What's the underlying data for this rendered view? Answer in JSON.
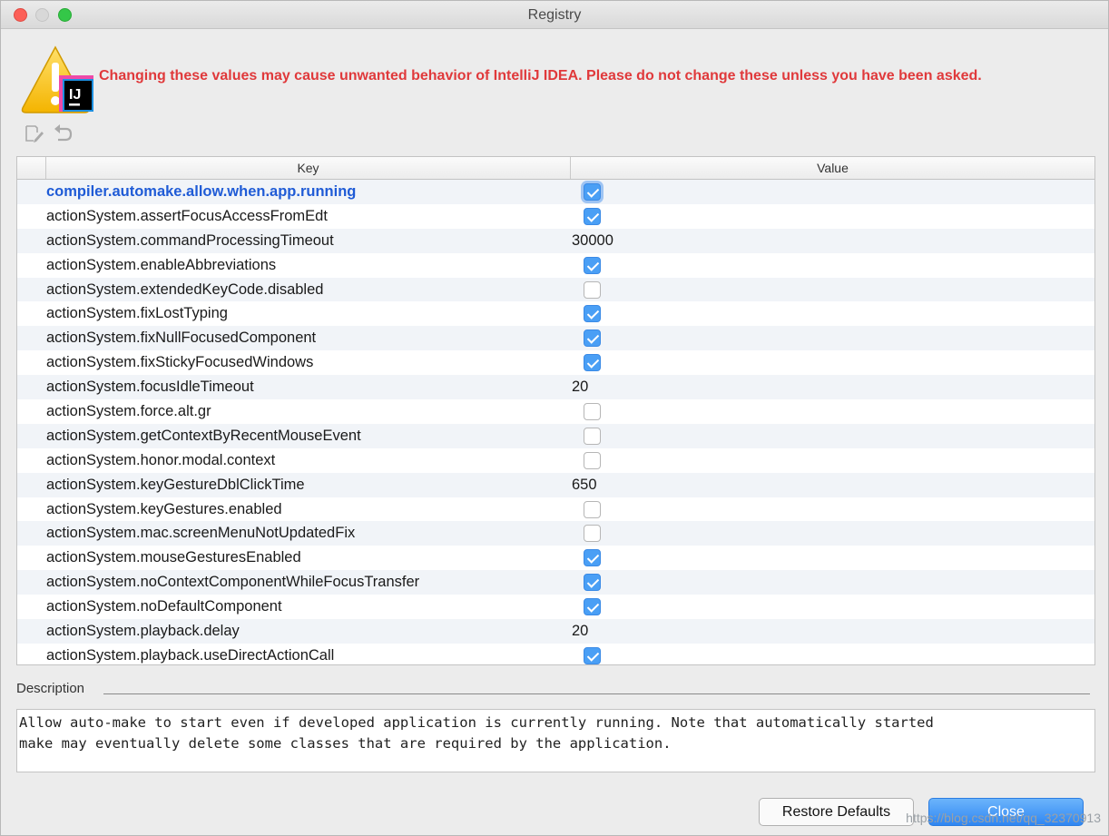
{
  "window": {
    "title": "Registry"
  },
  "header": {
    "warning_icon": "intellij-warning-icon",
    "warning_text": "Changing these values may cause unwanted behavior of IntelliJ IDEA. Please do not change these unless you have been asked."
  },
  "toolbar": {
    "edit_icon": "edit-icon",
    "undo_icon": "undo-icon"
  },
  "table": {
    "columns": [
      "Key",
      "Value"
    ],
    "rows": [
      {
        "key": "compiler.automake.allow.when.app.running",
        "type": "checkbox",
        "checked": true,
        "selected": true
      },
      {
        "key": "actionSystem.assertFocusAccessFromEdt",
        "type": "checkbox",
        "checked": true
      },
      {
        "key": "actionSystem.commandProcessingTimeout",
        "type": "text",
        "value": "30000"
      },
      {
        "key": "actionSystem.enableAbbreviations",
        "type": "checkbox",
        "checked": true
      },
      {
        "key": "actionSystem.extendedKeyCode.disabled",
        "type": "checkbox",
        "checked": false
      },
      {
        "key": "actionSystem.fixLostTyping",
        "type": "checkbox",
        "checked": true
      },
      {
        "key": "actionSystem.fixNullFocusedComponent",
        "type": "checkbox",
        "checked": true
      },
      {
        "key": "actionSystem.fixStickyFocusedWindows",
        "type": "checkbox",
        "checked": true
      },
      {
        "key": "actionSystem.focusIdleTimeout",
        "type": "text",
        "value": "20"
      },
      {
        "key": "actionSystem.force.alt.gr",
        "type": "checkbox",
        "checked": false
      },
      {
        "key": "actionSystem.getContextByRecentMouseEvent",
        "type": "checkbox",
        "checked": false
      },
      {
        "key": "actionSystem.honor.modal.context",
        "type": "checkbox",
        "checked": false
      },
      {
        "key": "actionSystem.keyGestureDblClickTime",
        "type": "text",
        "value": "650"
      },
      {
        "key": "actionSystem.keyGestures.enabled",
        "type": "checkbox",
        "checked": false
      },
      {
        "key": "actionSystem.mac.screenMenuNotUpdatedFix",
        "type": "checkbox",
        "checked": false
      },
      {
        "key": "actionSystem.mouseGesturesEnabled",
        "type": "checkbox",
        "checked": true
      },
      {
        "key": "actionSystem.noContextComponentWhileFocusTransfer",
        "type": "checkbox",
        "checked": true
      },
      {
        "key": "actionSystem.noDefaultComponent",
        "type": "checkbox",
        "checked": true
      },
      {
        "key": "actionSystem.playback.delay",
        "type": "text",
        "value": "20"
      },
      {
        "key": "actionSystem.playback.useDirectActionCall",
        "type": "checkbox",
        "checked": true
      }
    ]
  },
  "description": {
    "label": "Description",
    "text": "Allow auto-make to start even if developed application is currently running. Note that automatically started\nmake may eventually delete some classes that are required by the application."
  },
  "buttons": {
    "restore_label": "Restore Defaults",
    "close_label": "Close"
  },
  "watermark": "https://blog.csdn.net/qq_32370913",
  "colors": {
    "warning": "#e0393b",
    "selected_key": "#1f5bd6",
    "checkbox_checked": "#4a9ff5",
    "primary_button": "#3a8ef3"
  }
}
